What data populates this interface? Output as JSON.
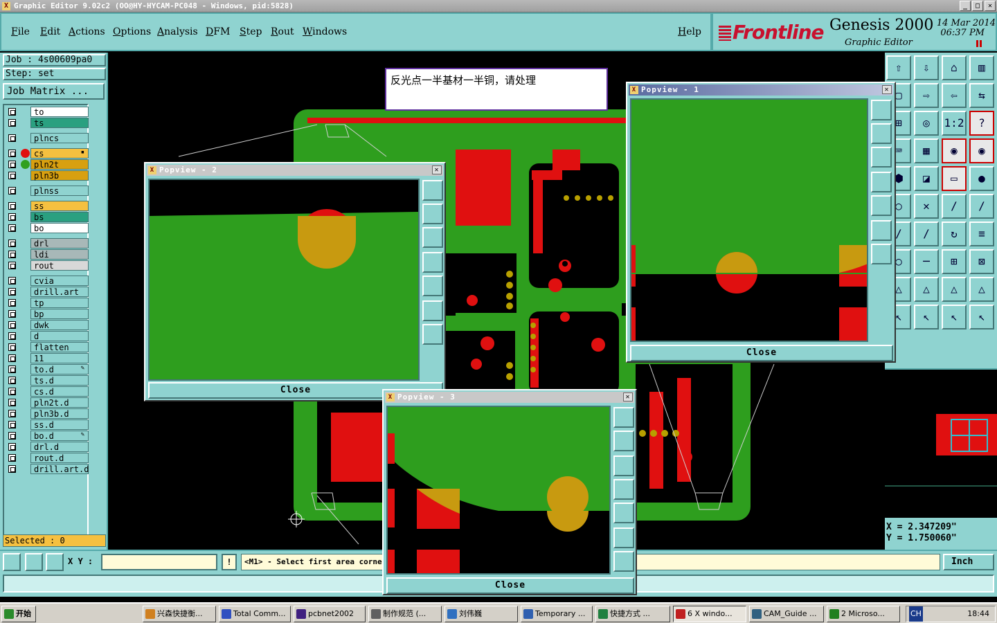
{
  "window": {
    "title": "Graphic Editor 9.02c2 (OO@HY-HYCAM-PC048 - Windows, pid:5828)"
  },
  "menu": {
    "file": "File",
    "edit": "Edit",
    "actions": "Actions",
    "options": "Options",
    "analysis": "Analysis",
    "dfm": "DFM",
    "step": "Step",
    "rout": "Rout",
    "windows": "Windows",
    "help": "Help"
  },
  "brand": {
    "logo": "Frontline",
    "product": "Genesis 2000",
    "subtitle": "Graphic Editor",
    "date": "14 Mar 2014",
    "time": "06:37 PM"
  },
  "job": {
    "job_line": "Job : 4s00609pa0",
    "step_line": "Step: set",
    "matrix_button": "Job Matrix ..."
  },
  "layers": [
    {
      "name": "to",
      "color": "#ffffff",
      "indicator": ""
    },
    {
      "name": "ts",
      "color": "#2aa080",
      "indicator": ""
    },
    {
      "name": "plncs",
      "color": "#8fd3d0",
      "indicator": ""
    },
    {
      "name": "cs",
      "color": "#f5c040",
      "indicator": "#e01010",
      "mark": "▪"
    },
    {
      "name": "pln2t",
      "color": "#d8a010",
      "indicator": "#30a020"
    },
    {
      "name": "pln3b",
      "color": "#d8a010",
      "indicator": ""
    },
    {
      "name": "plnss",
      "color": "#8fd3d0",
      "indicator": ""
    },
    {
      "name": "ss",
      "color": "#f5c040",
      "indicator": ""
    },
    {
      "name": "bs",
      "color": "#2aa080",
      "indicator": ""
    },
    {
      "name": "bo",
      "color": "#ffffff",
      "indicator": ""
    },
    {
      "name": "drl",
      "color": "#a8b8b8",
      "indicator": ""
    },
    {
      "name": "ldi",
      "color": "#a8b8b8",
      "indicator": ""
    },
    {
      "name": "rout",
      "color": "#d8d8d8",
      "indicator": ""
    },
    {
      "name": "cvia",
      "color": "#8fd3d0",
      "indicator": ""
    },
    {
      "name": "drill.art",
      "color": "#8fd3d0",
      "indicator": ""
    },
    {
      "name": "tp",
      "color": "#8fd3d0",
      "indicator": ""
    },
    {
      "name": "bp",
      "color": "#8fd3d0",
      "indicator": ""
    },
    {
      "name": "dwk",
      "color": "#8fd3d0",
      "indicator": ""
    },
    {
      "name": "d",
      "color": "#8fd3d0",
      "indicator": ""
    },
    {
      "name": "flatten",
      "color": "#8fd3d0",
      "indicator": ""
    },
    {
      "name": "11",
      "color": "#8fd3d0",
      "indicator": ""
    },
    {
      "name": "to.d",
      "color": "#8fd3d0",
      "indicator": "",
      "mark": "✎"
    },
    {
      "name": "ts.d",
      "color": "#8fd3d0",
      "indicator": ""
    },
    {
      "name": "cs.d",
      "color": "#8fd3d0",
      "indicator": ""
    },
    {
      "name": "pln2t.d",
      "color": "#8fd3d0",
      "indicator": ""
    },
    {
      "name": "pln3b.d",
      "color": "#8fd3d0",
      "indicator": ""
    },
    {
      "name": "ss.d",
      "color": "#8fd3d0",
      "indicator": ""
    },
    {
      "name": "bo.d",
      "color": "#8fd3d0",
      "indicator": "",
      "mark": "✎"
    },
    {
      "name": "drl.d",
      "color": "#8fd3d0",
      "indicator": ""
    },
    {
      "name": "rout.d",
      "color": "#8fd3d0",
      "indicator": ""
    },
    {
      "name": "drill.art.d",
      "color": "#8fd3d0",
      "indicator": ""
    }
  ],
  "selected": "Selected : 0",
  "note": "反光点一半基材一半铜，请处理",
  "popviews": [
    {
      "title": "Popview - 1",
      "close": "Close"
    },
    {
      "title": "Popview - 2",
      "close": "Close"
    },
    {
      "title": "Popview - 3",
      "close": "Close"
    }
  ],
  "bottom": {
    "xy_label": "X Y :",
    "xy_value": "",
    "info": "!",
    "prompt": "<M1> - Select first area corner",
    "unit": "Inch"
  },
  "coords": {
    "x": "X = 2.347209\"",
    "y": "Y = 1.750060\""
  },
  "taskbar": {
    "start": "开始",
    "tasks": [
      "兴森快捷衡...",
      "Total Comm...",
      "pcbnet2002",
      "制作规范 (...",
      "刘伟巍",
      "Temporary ...",
      "快捷方式 ...",
      "6 X windo...",
      "CAM_Guide ...",
      "2 Microso..."
    ],
    "lang": "CH",
    "clock": "18:44"
  },
  "colors": {
    "panel": "#8fd3d0",
    "board_green": "#2e9e1e",
    "copper_red": "#e01010",
    "pad_gold": "#b8a000"
  }
}
